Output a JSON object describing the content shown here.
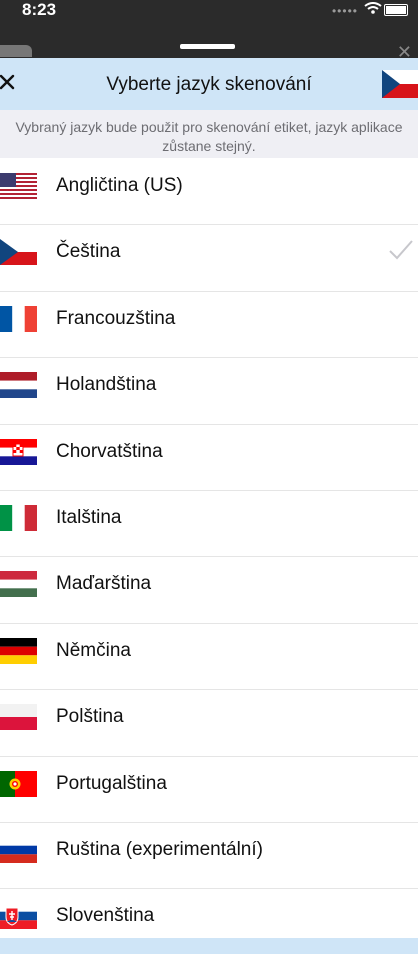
{
  "status": {
    "time": "8:23"
  },
  "header": {
    "title": "Vyberte jazyk skenování"
  },
  "subtitle": "Vybraný jazyk bude použit pro skenování etiket, jazyk aplikace zůstane stejný.",
  "languages": [
    {
      "label": "Angličtina (US)",
      "flag": "us-flag-icon",
      "selected": false
    },
    {
      "label": "Čeština",
      "flag": "cz-flag-icon",
      "selected": true
    },
    {
      "label": "Francouzština",
      "flag": "fr-flag-icon",
      "selected": false
    },
    {
      "label": "Holandština",
      "flag": "nl-flag-icon",
      "selected": false
    },
    {
      "label": "Chorvatština",
      "flag": "hr-flag-icon",
      "selected": false
    },
    {
      "label": "Italština",
      "flag": "it-flag-icon",
      "selected": false
    },
    {
      "label": "Maďarština",
      "flag": "hu-flag-icon",
      "selected": false
    },
    {
      "label": "Němčina",
      "flag": "de-flag-icon",
      "selected": false
    },
    {
      "label": "Polština",
      "flag": "pl-flag-icon",
      "selected": false
    },
    {
      "label": "Portugalština",
      "flag": "pt-flag-icon",
      "selected": false
    },
    {
      "label": "Ruština (experimentální)",
      "flag": "ru-flag-icon",
      "selected": false
    },
    {
      "label": "Slovenština",
      "flag": "sk-flag-icon",
      "selected": false
    }
  ],
  "colors": {
    "header_bg": "#cfe5f7",
    "subtitle_bg": "#efeff4",
    "check": "#c7c7cc"
  }
}
